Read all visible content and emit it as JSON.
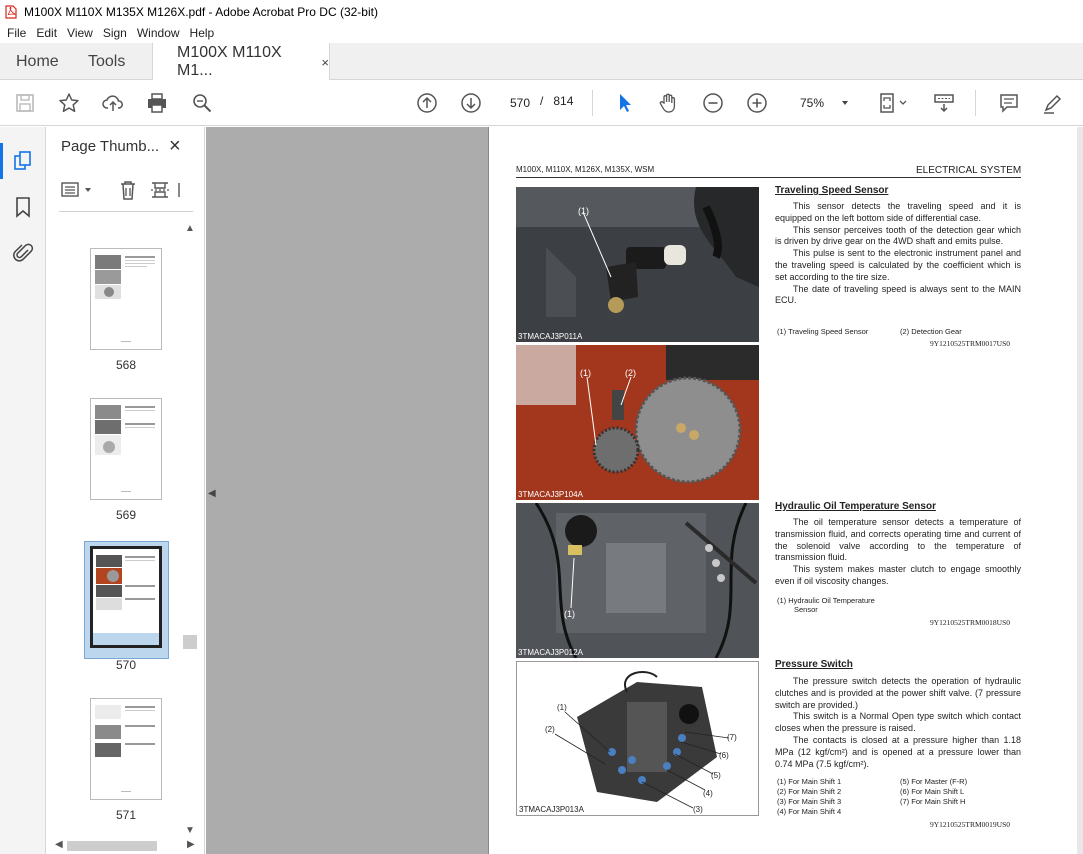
{
  "window": {
    "title": "M100X M110X M135X M126X.pdf - Adobe Acrobat Pro DC (32-bit)"
  },
  "menu": [
    "File",
    "Edit",
    "View",
    "Sign",
    "Window",
    "Help"
  ],
  "tabs": {
    "home": "Home",
    "tools": "Tools",
    "document": "M100X M110X M1...",
    "close": "×"
  },
  "toolbar": {
    "current_page": "570",
    "page_sep": "/",
    "total_pages": "814",
    "zoom": "75%",
    "icons": [
      "save-icon",
      "star-icon",
      "upload-icon",
      "print-icon",
      "zoom-search-icon",
      "page-up-icon",
      "page-down-icon",
      "select-cursor-icon",
      "hand-icon",
      "zoom-out-icon",
      "zoom-in-icon",
      "page-fit-icon",
      "scroll-mode-icon",
      "comment-icon",
      "highlight-pen-icon"
    ]
  },
  "panel": {
    "title": "Page Thumb...",
    "close": "×",
    "thumbnails": [
      {
        "page": "568"
      },
      {
        "page": "569"
      },
      {
        "page": "570",
        "selected": true
      },
      {
        "page": "571"
      }
    ]
  },
  "page": {
    "header_left": "M100X, M110X, M126X, M135X, WSM",
    "header_right": "ELECTRICAL SYSTEM",
    "photos": [
      "3TMACAJ3P011A",
      "3TMACAJ3P104A",
      "3TMACAJ3P012A",
      "3TMACAJ3P013A"
    ],
    "sections": [
      {
        "title": "Traveling Speed Sensor",
        "paragraphs": [
          "This sensor detects the traveling speed and it is equipped on the left bottom side of differential case.",
          "This sensor perceives tooth of the detection gear which is driven by drive gear on the 4WD shaft and emits pulse.",
          "This pulse is sent to the electronic instrument panel and the traveling speed is calculated by the coefficient which is set according to the tire size.",
          "The date of traveling speed is always sent to the MAIN ECU."
        ],
        "legend": [
          "(1)  Traveling Speed Sensor",
          "(2)  Detection Gear"
        ],
        "code": "9Y1210525TRM0017US0"
      },
      {
        "title": "Hydraulic Oil Temperature Sensor",
        "paragraphs": [
          "The oil temperature sensor detects a temperature of transmission fluid, and corrects operating time and current of the solenoid valve according to the temperature of transmission fluid.",
          "This system makes master clutch to engage smoothly even if oil viscosity changes."
        ],
        "legend": [
          "(1)  Hydraulic Oil Temperature",
          "Sensor"
        ],
        "code": "9Y1210525TRM0018US0"
      },
      {
        "title": "Pressure Switch",
        "paragraphs": [
          "The pressure switch detects the operation of hydraulic clutches and is provided at the power shift valve. (7 pressure switch are provided.)",
          "This switch is a Normal Open type switch which contact closes when the pressure is raised.",
          "The contacts is closed at a pressure higher than 1.18 MPa (12 kgf/cm²) and is opened at a pressure lower than 0.74 MPa (7.5 kgf/cm²)."
        ],
        "legend_left": [
          "(1)  For Main Shift 1",
          "(2)  For Main Shift 2",
          "(3)  For Main Shift 3",
          "(4)  For Main Shift 4"
        ],
        "legend_right": [
          "(5)  For Master (F-R)",
          "(6)  For Main Shift L",
          "(7)  For Main Shift H"
        ],
        "code": "9Y1210525TRM0019US0"
      }
    ],
    "callouts": [
      "(1)",
      "(2)",
      "(3)",
      "(4)",
      "(5)",
      "(6)",
      "(7)"
    ]
  }
}
